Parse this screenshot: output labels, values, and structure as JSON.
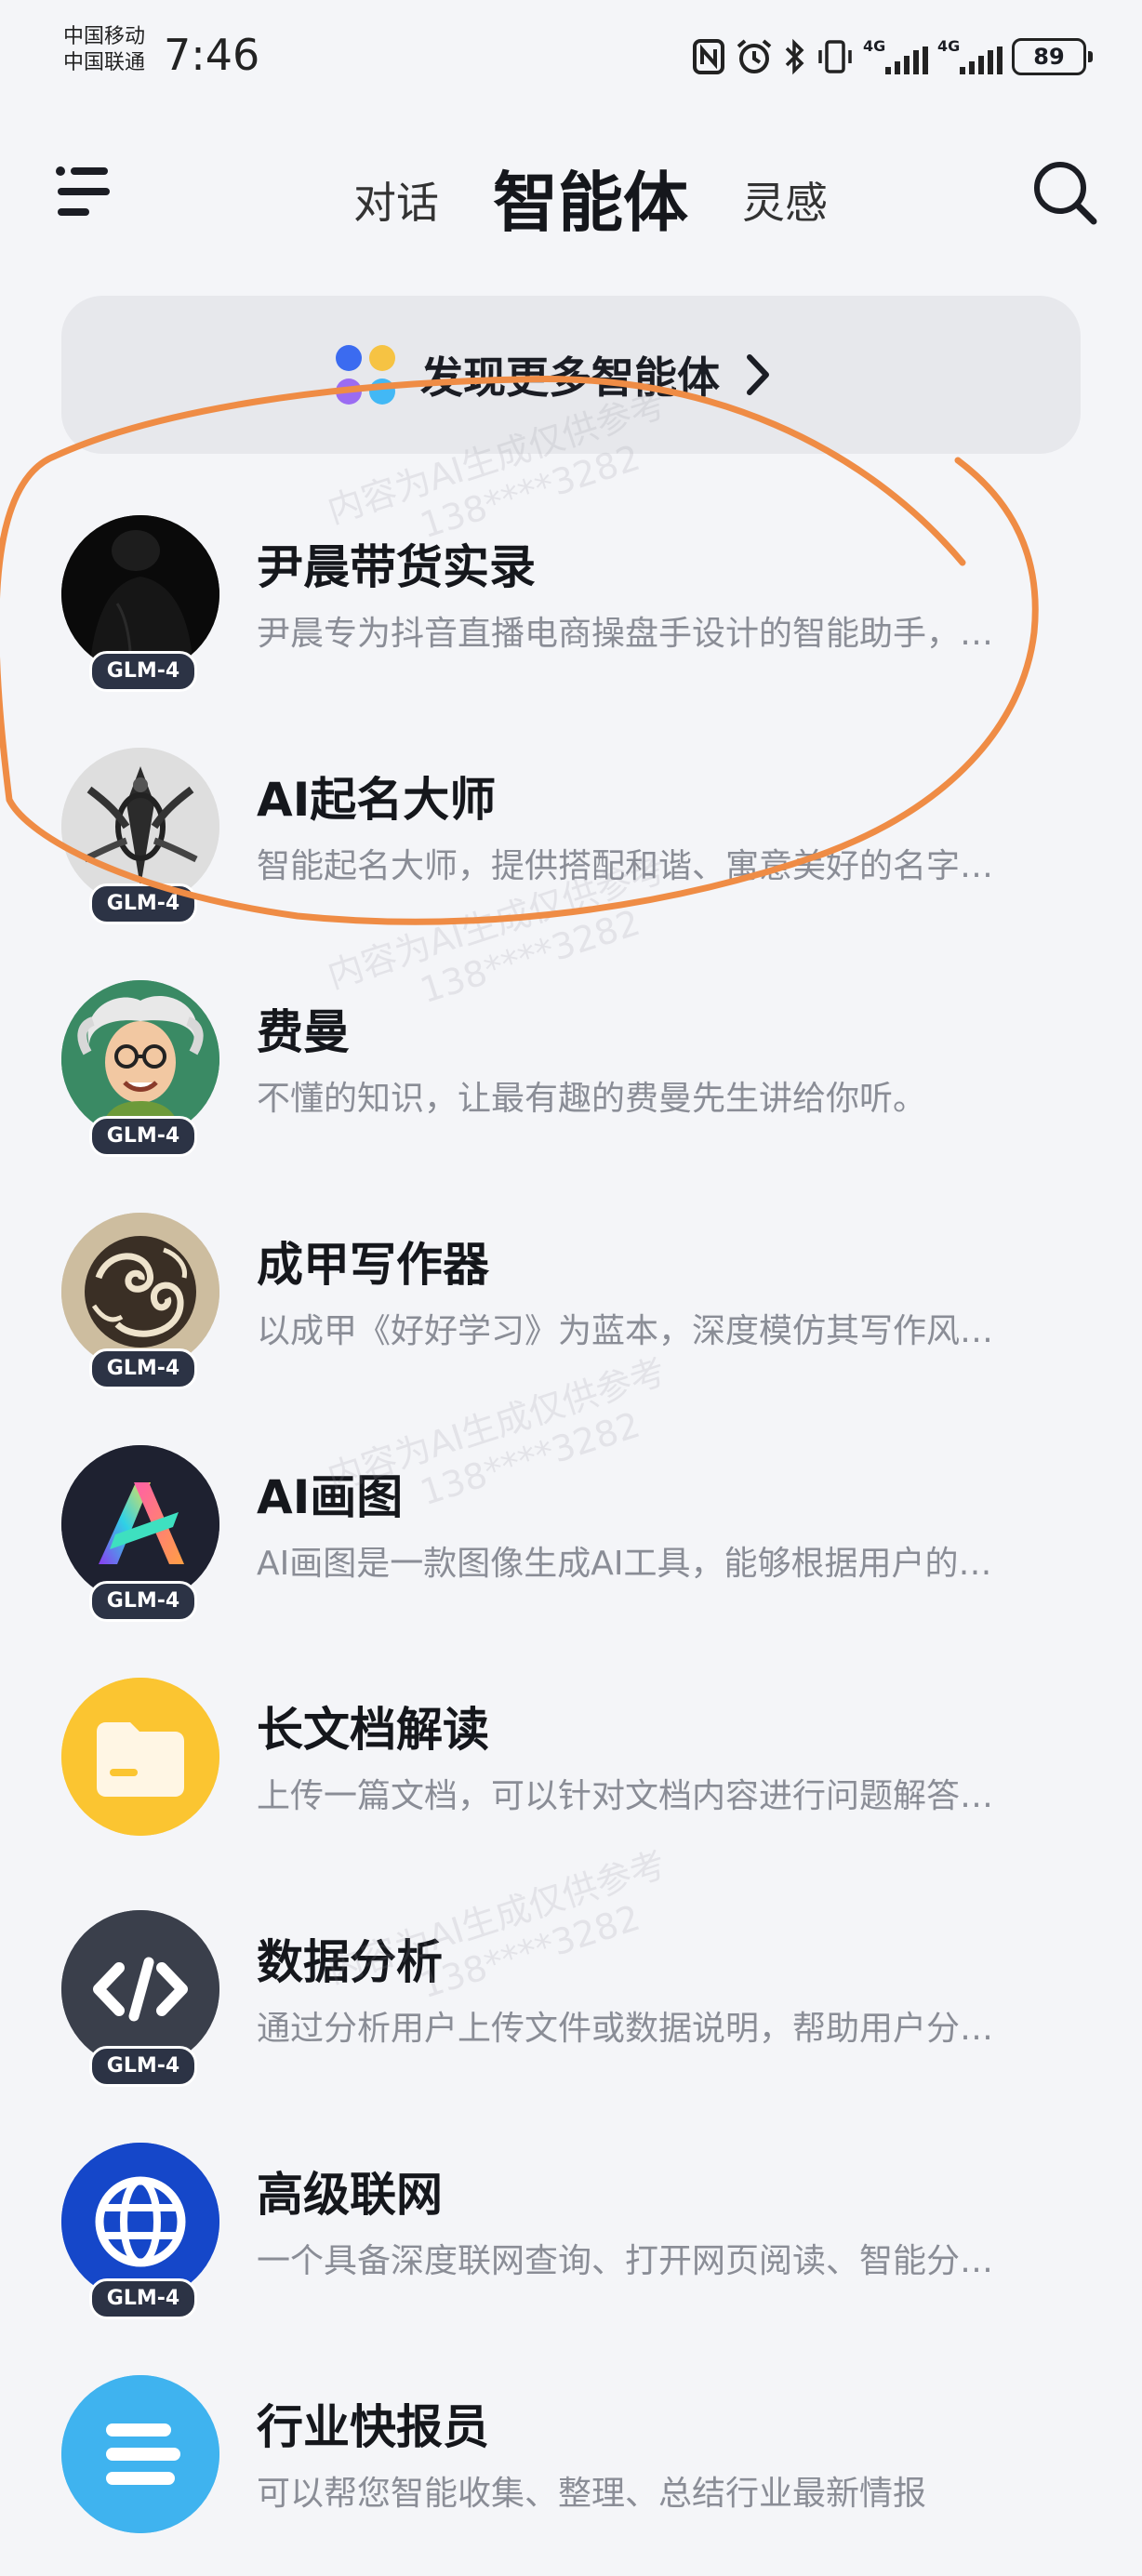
{
  "status_bar": {
    "carrier_1": "中国移动",
    "carrier_2": "中国联通",
    "time": "7:46",
    "battery": "89",
    "network_1": "4G",
    "network_2": "4G"
  },
  "header": {
    "tabs": [
      {
        "label": "对话"
      },
      {
        "label": "智能体"
      },
      {
        "label": "灵感"
      }
    ],
    "active_tab": "智能体"
  },
  "discover": {
    "label": "发现更多智能体"
  },
  "agents": [
    {
      "title": "尹晨带货实录",
      "desc": "尹晨专为抖音直播电商操盘手设计的智能助手，…",
      "badge": "GLM-4",
      "avatar": "person-silhouette"
    },
    {
      "title": "AI起名大师",
      "desc": "智能起名大师，提供搭配和谐、寓意美好的名字…",
      "badge": "GLM-4",
      "avatar": "ornament"
    },
    {
      "title": "费曼",
      "desc": "不懂的知识，让最有趣的费曼先生讲给你听。",
      "badge": "GLM-4",
      "avatar": "cartoon-professor"
    },
    {
      "title": "成甲写作器",
      "desc": "以成甲《好好学习》为蓝本，深度模仿其写作风…",
      "badge": "GLM-4",
      "avatar": "swirl-art"
    },
    {
      "title": "AI画图",
      "desc": "AI画图是一款图像生成AI工具，能够根据用户的…",
      "badge": "GLM-4",
      "avatar": "gradient-a"
    },
    {
      "title": "长文档解读",
      "desc": "上传一篇文档，可以针对文档内容进行问题解答…",
      "badge": "",
      "avatar": "folder"
    },
    {
      "title": "数据分析",
      "desc": "通过分析用户上传文件或数据说明，帮助用户分…",
      "badge": "GLM-4",
      "avatar": "code"
    },
    {
      "title": "高级联网",
      "desc": "一个具备深度联网查询、打开网页阅读、智能分…",
      "badge": "GLM-4",
      "avatar": "globe"
    },
    {
      "title": "行业快报员",
      "desc": "可以帮您智能收集、整理、总结行业最新情报",
      "badge": "",
      "avatar": "stack"
    }
  ],
  "watermark": {
    "line1": "内容为AI生成仅供参考",
    "line2": "138****3282"
  },
  "colors": {
    "background": "#f4f5f8",
    "annotation_stroke": "#ef8c45",
    "badge_bg": "#2c3345"
  }
}
